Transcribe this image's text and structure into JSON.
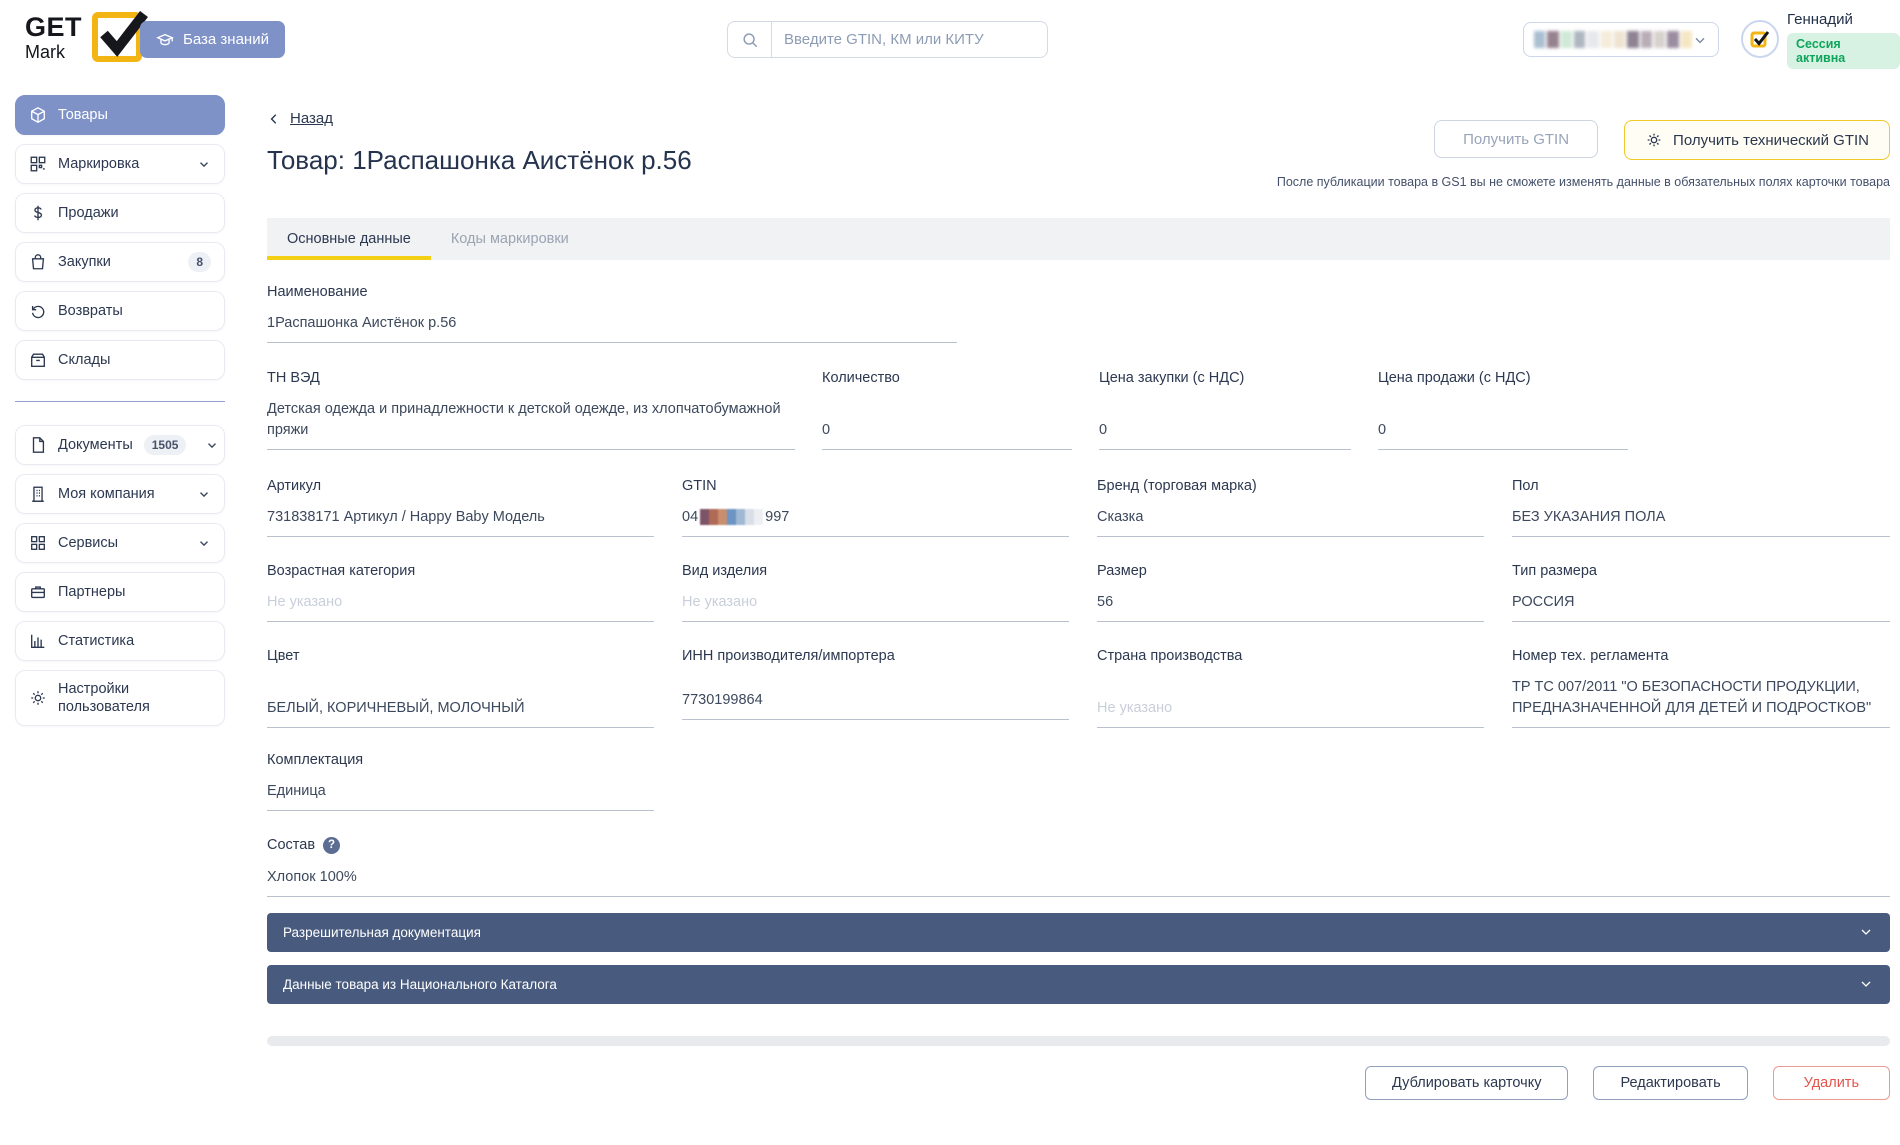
{
  "header": {
    "logo_line1": "GET",
    "logo_line2": "Mark",
    "knowledge_base_button": "База знаний",
    "search_placeholder": "Введите GTIN, КМ или КИТУ",
    "org_blur_colors": [
      "#aabfd2",
      "#96828f",
      "#cfe9d6",
      "#aeb6c0",
      "#e6e9ec",
      "#f5ecd9",
      "#efe3d2",
      "#8f8292",
      "#b9aeb6",
      "#d8d2ce",
      "#9b8da0",
      "#f6e7c4"
    ],
    "user": {
      "name": "Геннадий",
      "session_badge": "Сессия активна"
    }
  },
  "sidebar": {
    "items": [
      {
        "label": "Товары",
        "active": true
      },
      {
        "label": "Маркировка",
        "chevron": true
      },
      {
        "label": "Продажи"
      },
      {
        "label": "Закупки",
        "badge": "8"
      },
      {
        "label": "Возвраты"
      },
      {
        "label": "Склады"
      },
      {
        "label": "Документы",
        "badge": "1505",
        "chevron": true
      },
      {
        "label": "Моя компания",
        "chevron": true
      },
      {
        "label": "Сервисы",
        "chevron": true
      },
      {
        "label": "Партнеры"
      },
      {
        "label": "Статистика"
      },
      {
        "label": "Настройки пользователя"
      }
    ]
  },
  "page": {
    "back_link": "Назад",
    "title": "Товар: 1Распашонка Аистёнок р.56",
    "get_gtin_button": "Получить GTIN",
    "get_tech_gtin_button": "Получить технический GTIN",
    "gs1_note": "После публикации товара в GS1 вы не сможете изменять данные в обязательных полях карточки товара",
    "tabs": [
      {
        "label": "Основные данные",
        "active": true
      },
      {
        "label": "Коды маркировки",
        "active": false
      }
    ]
  },
  "fields": {
    "naimenovanie": {
      "label": "Наименование",
      "value": "1Распашонка Аистёнок р.56"
    },
    "tnved": {
      "label": "ТН ВЭД",
      "value": "Детская одежда и принадлежности к детской одежде, из хлопчатобумажной пряжи"
    },
    "kolichestvo": {
      "label": "Количество",
      "value": "0"
    },
    "cena_zakupki": {
      "label": "Цена закупки (с НДС)",
      "value": "0"
    },
    "cena_prodazhi": {
      "label": "Цена продажи (с НДС)",
      "value": "0"
    },
    "artikul": {
      "label": "Артикул",
      "value": "731838171 Артикул / Happy Baby Модель"
    },
    "gtin": {
      "label": "GTIN",
      "value_prefix": "04",
      "value_suffix": "997",
      "redacted_colors": [
        "#7d5368",
        "#b06a56",
        "#c98e6d",
        "#6d94c2",
        "#9fb8d4",
        "#d9dfe7",
        "#edeff3"
      ]
    },
    "brend": {
      "label": "Бренд (торговая марка)",
      "value": "Сказка"
    },
    "pol": {
      "label": "Пол",
      "value": "БЕЗ УКАЗАНИЯ ПОЛА"
    },
    "vozrast": {
      "label": "Возрастная категория",
      "placeholder": "Не указано"
    },
    "vid": {
      "label": "Вид изделия",
      "placeholder": "Не указано"
    },
    "razmer": {
      "label": "Размер",
      "value": "56"
    },
    "tip_razmera": {
      "label": "Тип размера",
      "value": "РОССИЯ"
    },
    "cvet": {
      "label": "Цвет",
      "value": "БЕЛЫЙ, КОРИЧНЕВЫЙ, МОЛОЧНЫЙ"
    },
    "inn": {
      "label": "ИНН производителя/импортера",
      "value": "7730199864"
    },
    "strana": {
      "label": "Страна производства",
      "placeholder": "Не указано"
    },
    "reglament": {
      "label": "Номер тех. регламента",
      "value": "ТР ТС 007/2011 \"О БЕЗОПАСНОСТИ ПРОДУКЦИИ, ПРЕДНАЗНАЧЕННОЙ ДЛЯ ДЕТЕЙ И ПОДРОСТКОВ\""
    },
    "komplektaciya": {
      "label": "Комплектация",
      "value": "Единица"
    },
    "sostav": {
      "label": "Состав",
      "value": "Хлопок 100%",
      "help": "?"
    }
  },
  "accordions": [
    {
      "title": "Разрешительная документация"
    },
    {
      "title": "Данные товара из Национального Каталога"
    }
  ],
  "footer_buttons": {
    "duplicate": "Дублировать карточку",
    "edit": "Редактировать",
    "delete": "Удалить"
  },
  "colors": {
    "primary_blue": "#7e92c8",
    "accent_yellow": "#f3d014",
    "logo_yellow": "#f2b514",
    "accordion_blue": "#485b7e",
    "session_green_bg": "#d7f2e2",
    "session_green_text": "#0fa45c",
    "danger_red": "#e4554b"
  }
}
